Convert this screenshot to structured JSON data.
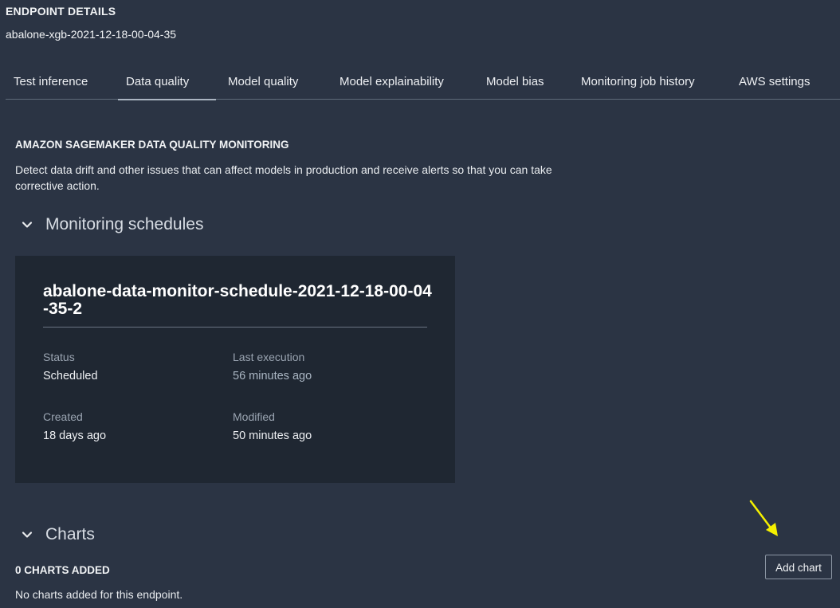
{
  "header": {
    "label": "ENDPOINT DETAILS",
    "endpoint_name": "abalone-xgb-2021-12-18-00-04-35"
  },
  "tabs": [
    {
      "label": "Test inference",
      "active": false
    },
    {
      "label": "Data quality",
      "active": true
    },
    {
      "label": "Model quality",
      "active": false
    },
    {
      "label": "Model explainability",
      "active": false
    },
    {
      "label": "Model bias",
      "active": false
    },
    {
      "label": "Monitoring job history",
      "active": false
    },
    {
      "label": "AWS settings",
      "active": false
    }
  ],
  "section": {
    "title": "AMAZON SAGEMAKER DATA QUALITY MONITORING",
    "description": "Detect data drift and other issues that can affect models in production and receive alerts so that you can take corrective action."
  },
  "monitoring_schedules": {
    "heading": "Monitoring schedules",
    "expanded": true,
    "schedule": {
      "name": "abalone-data-monitor-schedule-2021-12-18-00-04-35-2",
      "status_label": "Status",
      "status_value": "Scheduled",
      "last_execution_label": "Last execution",
      "last_execution_value": "56 minutes ago",
      "created_label": "Created",
      "created_value": "18 days ago",
      "modified_label": "Modified",
      "modified_value": "50 minutes ago"
    }
  },
  "charts": {
    "heading": "Charts",
    "expanded": true,
    "count_label": "0 CHARTS ADDED",
    "empty_message": "No charts added for this endpoint.",
    "add_button_label": "Add chart"
  },
  "colors": {
    "background": "#2b3444",
    "card": "#1f2732",
    "annotation_arrow": "#f5f000"
  },
  "icons": {
    "section_toggle": "chevron-down-icon",
    "annotation": "arrow-annotation-icon"
  }
}
